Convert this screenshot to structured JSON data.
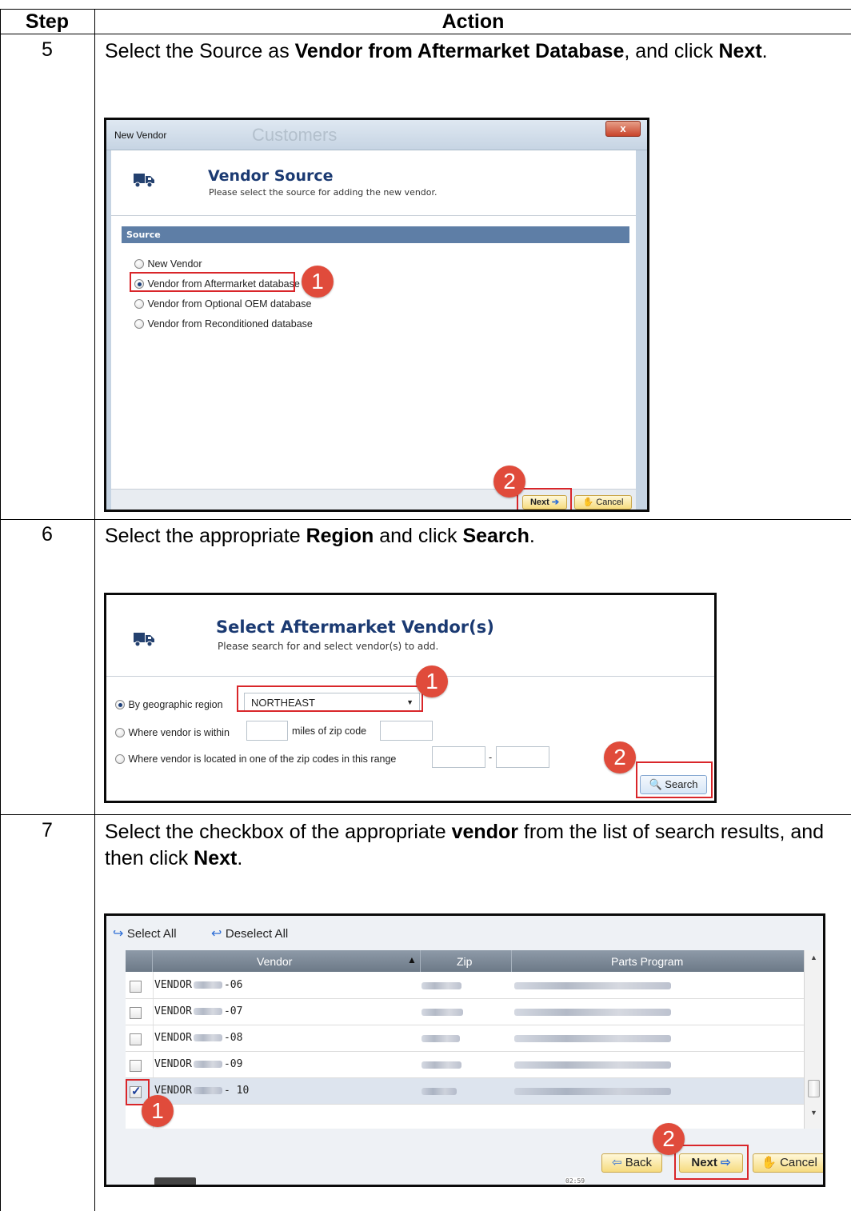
{
  "table": {
    "headers": {
      "step": "Step",
      "action": "Action"
    },
    "rows": [
      {
        "step": "5",
        "text_pre": "Select the Source as ",
        "text_bold1": "Vendor from Aftermarket Database",
        "text_mid": ", and click ",
        "text_bold2": "Next",
        "text_post": "."
      },
      {
        "step": "6",
        "text_pre": "Select the appropriate ",
        "text_bold1": "Region",
        "text_mid": " and click ",
        "text_bold2": "Search",
        "text_post": "."
      },
      {
        "step": "7",
        "text_pre": "Select the checkbox of the appropriate ",
        "text_bold1": "vendor",
        "text_mid": " from the list of search results, and then click ",
        "text_bold2": "Next",
        "text_post": "."
      }
    ]
  },
  "shot1": {
    "window_title": "New Vendor",
    "bg_title": "Customers",
    "close_glyph": "x",
    "title": "Vendor Source",
    "subtitle": "Please select the source for adding the new vendor.",
    "section_label": "Source",
    "options": [
      {
        "label": "New Vendor",
        "selected": false
      },
      {
        "label": "Vendor from Aftermarket database",
        "selected": true
      },
      {
        "label": "Vendor from Optional OEM database",
        "selected": false
      },
      {
        "label": "Vendor from Reconditioned database",
        "selected": false
      }
    ],
    "badge1": "1",
    "badge2": "2",
    "next_label": "Next",
    "cancel_label": "Cancel"
  },
  "shot2": {
    "title": "Select Aftermarket Vendor(s)",
    "subtitle": "Please search for and select vendor(s) to add.",
    "opt_region": "By geographic region",
    "region_value": "NORTHEAST",
    "opt_within_pre": "Where vendor is within",
    "opt_within_post": "miles of zip code",
    "opt_range": "Where vendor is located in one of the zip codes in this range",
    "range_dash": "-",
    "badge1": "1",
    "badge2": "2",
    "search_label": "Search"
  },
  "shot3": {
    "select_all": "Select All",
    "deselect_all": "Deselect All",
    "columns": [
      "Vendor",
      "Zip",
      "Parts Program"
    ],
    "rows": [
      {
        "prefix": "VENDOR",
        "suffix": "-06",
        "checked": false
      },
      {
        "prefix": "VENDOR",
        "suffix": "-07",
        "checked": false
      },
      {
        "prefix": "VENDOR",
        "suffix": "-08",
        "checked": false
      },
      {
        "prefix": "VENDOR",
        "suffix": "-09",
        "checked": false
      },
      {
        "prefix": "VENDOR",
        "suffix": "- 10",
        "checked": true
      }
    ],
    "badge1": "1",
    "badge2": "2",
    "back_label": "Back",
    "next_label": "Next",
    "cancel_label": "Cancel",
    "timestamp": "02:59"
  },
  "colors": {
    "badge": "#e04b3b",
    "highlight": "#d9262a",
    "title_blue": "#1b3a72",
    "section_bar": "#5e7ea6"
  }
}
